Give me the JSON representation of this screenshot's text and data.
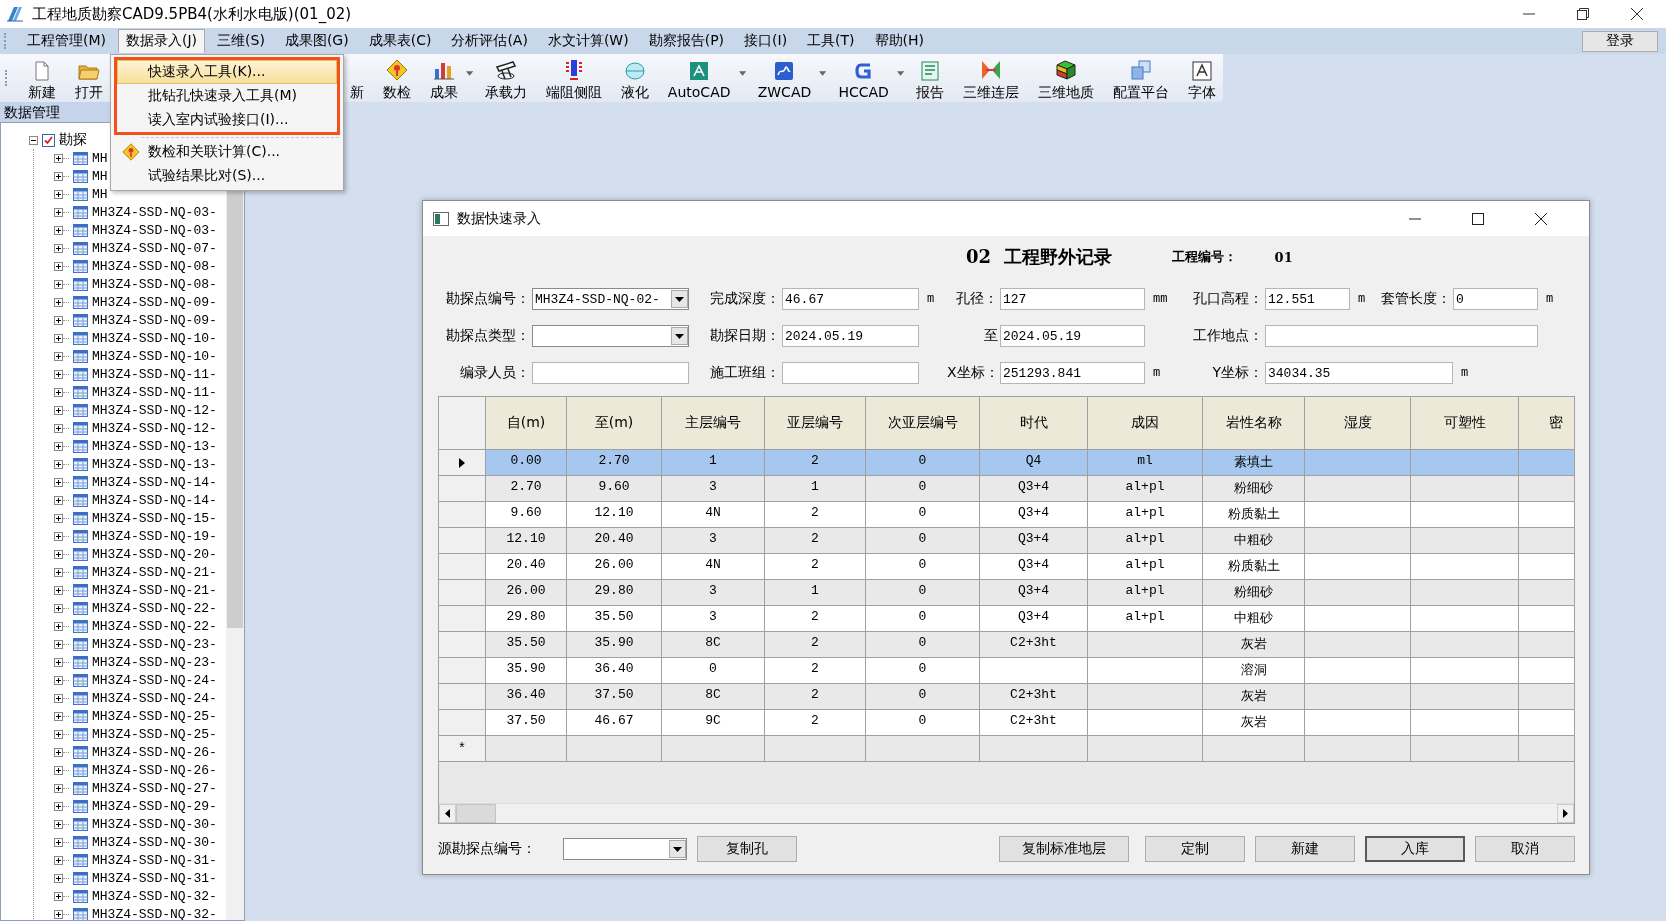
{
  "window": {
    "title": "工程地质勘察CAD9.5PB4(水利水电版)(01_02)"
  },
  "menu_bar": {
    "items": [
      {
        "label": "工程管理(M)",
        "selected": false
      },
      {
        "label": "数据录入(J)",
        "selected": true
      },
      {
        "label": "三维(S)",
        "selected": false
      },
      {
        "label": "成果图(G)",
        "selected": false
      },
      {
        "label": "成果表(C)",
        "selected": false
      },
      {
        "label": "分析评估(A)",
        "selected": false
      },
      {
        "label": "水文计算(W)",
        "selected": false
      },
      {
        "label": "勘察报告(P)",
        "selected": false
      },
      {
        "label": "接口(I)",
        "selected": false
      },
      {
        "label": "工具(T)",
        "selected": false
      },
      {
        "label": "帮助(H)",
        "selected": false
      }
    ],
    "login_button": "登录"
  },
  "toolbar": {
    "items": [
      {
        "kind": "button",
        "label": "新建",
        "dropdown": false
      },
      {
        "kind": "button",
        "label": "打开",
        "dropdown": false
      },
      {
        "kind": "covered",
        "label": "新",
        "dropdown": false
      },
      {
        "kind": "button",
        "label": "数检",
        "dropdown": false
      },
      {
        "kind": "button",
        "label": "成果",
        "dropdown": true
      },
      {
        "kind": "button",
        "label": "承载力",
        "dropdown": false
      },
      {
        "kind": "button",
        "label": "端阻侧阻",
        "dropdown": false
      },
      {
        "kind": "button",
        "label": "液化",
        "dropdown": false
      },
      {
        "kind": "button",
        "label": "AutoCAD",
        "dropdown": true
      },
      {
        "kind": "button",
        "label": "ZWCAD",
        "dropdown": true
      },
      {
        "kind": "button",
        "label": "HCCAD",
        "dropdown": true
      },
      {
        "kind": "button",
        "label": "报告",
        "dropdown": false
      },
      {
        "kind": "button",
        "label": "三维连层",
        "dropdown": false
      },
      {
        "kind": "button",
        "label": "三维地质",
        "dropdown": false
      },
      {
        "kind": "button",
        "label": "配置平台",
        "dropdown": false
      },
      {
        "kind": "button",
        "label": "字体",
        "dropdown": false
      }
    ]
  },
  "open_menu": {
    "sections": [
      {
        "framed": true,
        "items": [
          {
            "label": "快速录入工具(K)...",
            "selected": true,
            "has_icon": false
          },
          {
            "label": "批钻孔快速录入工具(M)",
            "selected": false,
            "has_icon": false
          },
          {
            "label": "读入室内试验接口(I)...",
            "selected": false,
            "has_icon": false
          }
        ]
      },
      {
        "framed": false,
        "items": [
          {
            "label": "数检和关联计算(C)...",
            "selected": false,
            "has_icon": true
          },
          {
            "label": "试验结果比对(S)...",
            "selected": false,
            "has_icon": false
          }
        ]
      }
    ]
  },
  "data_panel": {
    "title": "数据管理",
    "tree": {
      "label": "勘探",
      "checked": true,
      "expanded": true,
      "children": [
        {
          "label": "MH",
          "expanded": false
        },
        {
          "label": "MH",
          "expanded": false
        },
        {
          "label": "MH",
          "expanded": false
        },
        {
          "label": "MH3Z4-SSD-NQ-03-",
          "expanded": false
        },
        {
          "label": "MH3Z4-SSD-NQ-03-",
          "expanded": false
        },
        {
          "label": "MH3Z4-SSD-NQ-07-",
          "expanded": false
        },
        {
          "label": "MH3Z4-SSD-NQ-08-",
          "expanded": false
        },
        {
          "label": "MH3Z4-SSD-NQ-08-",
          "expanded": false
        },
        {
          "label": "MH3Z4-SSD-NQ-09-",
          "expanded": false
        },
        {
          "label": "MH3Z4-SSD-NQ-09-",
          "expanded": false
        },
        {
          "label": "MH3Z4-SSD-NQ-10-",
          "expanded": false
        },
        {
          "label": "MH3Z4-SSD-NQ-10-",
          "expanded": false
        },
        {
          "label": "MH3Z4-SSD-NQ-11-",
          "expanded": false
        },
        {
          "label": "MH3Z4-SSD-NQ-11-",
          "expanded": false
        },
        {
          "label": "MH3Z4-SSD-NQ-12-",
          "expanded": false
        },
        {
          "label": "MH3Z4-SSD-NQ-12-",
          "expanded": false
        },
        {
          "label": "MH3Z4-SSD-NQ-13-",
          "expanded": false
        },
        {
          "label": "MH3Z4-SSD-NQ-13-",
          "expanded": false
        },
        {
          "label": "MH3Z4-SSD-NQ-14-",
          "expanded": false
        },
        {
          "label": "MH3Z4-SSD-NQ-14-",
          "expanded": false
        },
        {
          "label": "MH3Z4-SSD-NQ-15-",
          "expanded": false
        },
        {
          "label": "MH3Z4-SSD-NQ-19-",
          "expanded": false
        },
        {
          "label": "MH3Z4-SSD-NQ-20-",
          "expanded": false
        },
        {
          "label": "MH3Z4-SSD-NQ-21-",
          "expanded": false
        },
        {
          "label": "MH3Z4-SSD-NQ-21-",
          "expanded": false
        },
        {
          "label": "MH3Z4-SSD-NQ-22-",
          "expanded": false
        },
        {
          "label": "MH3Z4-SSD-NQ-22-",
          "expanded": false
        },
        {
          "label": "MH3Z4-SSD-NQ-23-",
          "expanded": false
        },
        {
          "label": "MH3Z4-SSD-NQ-23-",
          "expanded": false
        },
        {
          "label": "MH3Z4-SSD-NQ-24-",
          "expanded": false
        },
        {
          "label": "MH3Z4-SSD-NQ-24-",
          "expanded": false
        },
        {
          "label": "MH3Z4-SSD-NQ-25-",
          "expanded": false
        },
        {
          "label": "MH3Z4-SSD-NQ-25-",
          "expanded": false
        },
        {
          "label": "MH3Z4-SSD-NQ-26-",
          "expanded": false
        },
        {
          "label": "MH3Z4-SSD-NQ-26-",
          "expanded": false
        },
        {
          "label": "MH3Z4-SSD-NQ-27-",
          "expanded": false
        },
        {
          "label": "MH3Z4-SSD-NQ-29-",
          "expanded": false
        },
        {
          "label": "MH3Z4-SSD-NQ-30-",
          "expanded": false
        },
        {
          "label": "MH3Z4-SSD-NQ-30-",
          "expanded": false
        },
        {
          "label": "MH3Z4-SSD-NQ-31-",
          "expanded": false
        },
        {
          "label": "MH3Z4-SSD-NQ-31-",
          "expanded": false
        },
        {
          "label": "MH3Z4-SSD-NQ-32-",
          "expanded": false
        },
        {
          "label": "MH3Z4-SSD-NQ-32-",
          "expanded": false
        }
      ]
    }
  },
  "dialog": {
    "title": "数据快速录入",
    "heading": "02  工程野外记录",
    "project_label": "工程编号：",
    "project_number": "01",
    "form_rows": [
      [
        {
          "label": "勘探点编号：",
          "kind": "select",
          "value": "MH3Z4-SSD-NQ-02-"
        },
        {
          "label": "完成深度：",
          "kind": "input",
          "value": "46.67",
          "unit": "m"
        },
        {
          "label": "孔径：",
          "kind": "input",
          "value": "127",
          "unit": "mm"
        },
        {
          "label": "孔口高程：",
          "kind": "input",
          "value": "12.551",
          "unit": "m"
        },
        {
          "label": "套管长度：",
          "kind": "input",
          "value": "0",
          "unit": "m"
        }
      ],
      [
        {
          "label": "勘探点类型：",
          "kind": "select"
        },
        {
          "label": "勘探日期：",
          "kind": "input",
          "value": "2024.05.19"
        },
        {
          "label": "至",
          "kind": "input",
          "value": "2024.05.19"
        },
        {
          "label": "工作地点：",
          "kind": "input"
        }
      ],
      [
        {
          "label": "编录人员：",
          "kind": "input"
        },
        {
          "label": "施工班组：",
          "kind": "input"
        },
        {
          "label": "X坐标：",
          "kind": "input",
          "value": "251293.841",
          "unit": "m"
        },
        {
          "label": "Y坐标：",
          "kind": "input",
          "value": "34034.35",
          "unit": "m"
        }
      ]
    ],
    "grid": {
      "columns": [
        "自(m)",
        "至(m)",
        "主层编号",
        "亚层编号",
        "次亚层编号",
        "时代",
        "成因",
        "岩性名称",
        "湿度",
        "可塑性",
        "密"
      ],
      "rows": [
        {
          "selected": true,
          "cells": [
            "0.00",
            "2.70",
            "1",
            "2",
            "0",
            "Q4",
            "ml",
            "素填土",
            null,
            null,
            null
          ]
        },
        {
          "selected": false,
          "cells": [
            "2.70",
            "9.60",
            "3",
            "1",
            "0",
            "Q3+4",
            "al+pl",
            "粉细砂",
            null,
            null,
            null
          ]
        },
        {
          "selected": false,
          "cells": [
            "9.60",
            "12.10",
            "4N",
            "2",
            "0",
            "Q3+4",
            "al+pl",
            "粉质黏土",
            null,
            null,
            null
          ]
        },
        {
          "selected": false,
          "cells": [
            "12.10",
            "20.40",
            "3",
            "2",
            "0",
            "Q3+4",
            "al+pl",
            "中粗砂",
            null,
            null,
            null
          ]
        },
        {
          "selected": false,
          "cells": [
            "20.40",
            "26.00",
            "4N",
            "2",
            "0",
            "Q3+4",
            "al+pl",
            "粉质黏土",
            null,
            null,
            null
          ]
        },
        {
          "selected": false,
          "cells": [
            "26.00",
            "29.80",
            "3",
            "1",
            "0",
            "Q3+4",
            "al+pl",
            "粉细砂",
            null,
            null,
            null
          ]
        },
        {
          "selected": false,
          "cells": [
            "29.80",
            "35.50",
            "3",
            "2",
            "0",
            "Q3+4",
            "al+pl",
            "中粗砂",
            null,
            null,
            null
          ]
        },
        {
          "selected": false,
          "cells": [
            "35.50",
            "35.90",
            "8C",
            "2",
            "0",
            "C2+3ht",
            null,
            "灰岩",
            null,
            null,
            null
          ]
        },
        {
          "selected": false,
          "cells": [
            "35.90",
            "36.40",
            "0",
            "2",
            "0",
            null,
            null,
            "溶洞",
            null,
            null,
            null
          ]
        },
        {
          "selected": false,
          "cells": [
            "36.40",
            "37.50",
            "8C",
            "2",
            "0",
            "C2+3ht",
            null,
            "灰岩",
            null,
            null,
            null
          ]
        },
        {
          "selected": false,
          "cells": [
            "37.50",
            "46.67",
            "9C",
            "2",
            "0",
            "C2+3ht",
            null,
            "灰岩",
            null,
            null,
            null
          ]
        }
      ],
      "new_row_marker": "*"
    },
    "source_label": "源勘探点编号：",
    "copy_hole_button": "复制孔",
    "buttons": [
      {
        "label": "复制标准地层",
        "default": false
      },
      {
        "label": "定制",
        "default": false
      },
      {
        "label": "新建",
        "default": false
      },
      {
        "label": "入库",
        "default": true
      },
      {
        "label": "取消",
        "default": false
      }
    ]
  }
}
